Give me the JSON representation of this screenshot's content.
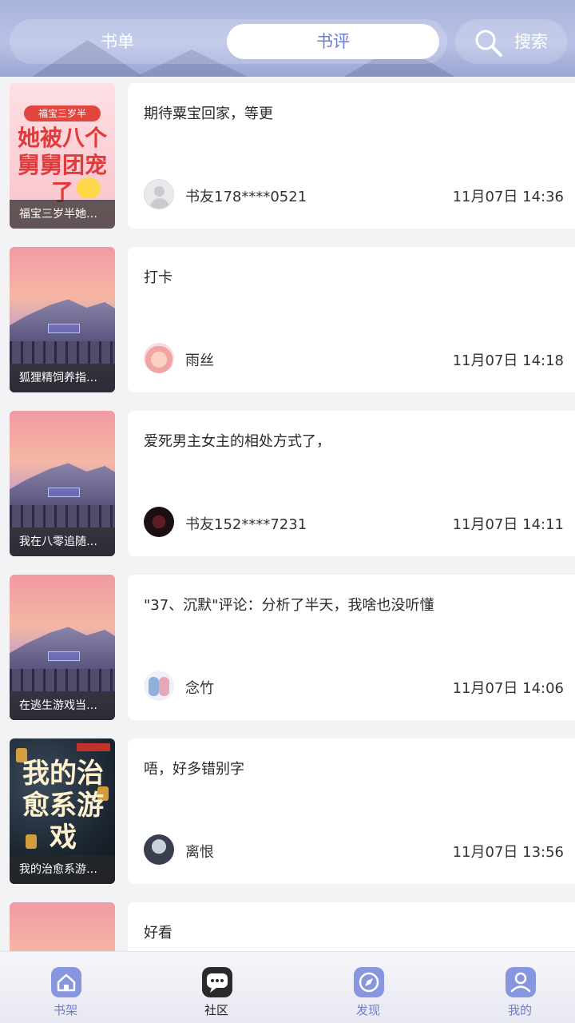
{
  "header": {
    "tab_booklist": "书单",
    "tab_review": "书评",
    "search_label": "搜索"
  },
  "reviews": [
    {
      "book_title": "福宝三岁半她…",
      "comment": "期待粟宝回家，等更",
      "user": "书友178****0521",
      "time": "11月07日 14:36"
    },
    {
      "book_title": "狐狸精饲养指…",
      "comment": "打卡",
      "user": "雨丝",
      "time": "11月07日 14:18"
    },
    {
      "book_title": "我在八零追随…",
      "comment": "爱死男主女主的相处方式了，",
      "user": "书友152****7231",
      "time": "11月07日 14:11"
    },
    {
      "book_title": "在逃生游戏当…",
      "comment": "\"37、沉默\"评论：分析了半天，我啥也没听懂",
      "user": "念竹",
      "time": "11月07日 14:06"
    },
    {
      "book_title": "我的治愈系游…",
      "comment": "唔，好多错别字",
      "user": "离恨",
      "time": "11月07日 13:56"
    },
    {
      "book_title": "",
      "comment": "好看",
      "user": "",
      "time": ""
    }
  ],
  "cover_texts": {
    "pink_banner": "福宝三岁半",
    "pink_title": "她被八个舅舅团宠了",
    "dark_title": "我的治愈系游戏"
  },
  "nav": {
    "shelf": "书架",
    "community": "社区",
    "discover": "发现",
    "mine": "我的"
  },
  "colors": {
    "accent": "#6c7ad3",
    "header_bg": "#b8c1e6",
    "page_bg": "#f3f3f5"
  },
  "icons": [
    "search-icon",
    "home-icon",
    "chat-icon",
    "compass-icon",
    "user-icon"
  ]
}
